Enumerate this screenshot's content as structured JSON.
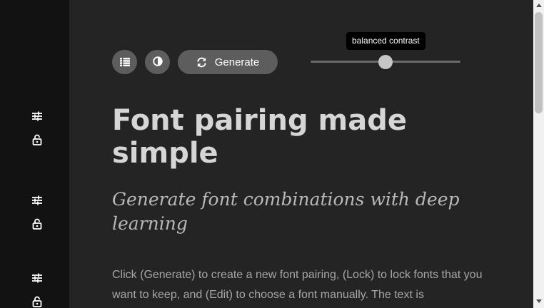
{
  "sidebar": {
    "groups": [
      {
        "settings_icon": "tune-icon",
        "lock_icon": "lock-open-icon"
      },
      {
        "settings_icon": "tune-icon",
        "lock_icon": "lock-open-icon"
      },
      {
        "settings_icon": "tune-icon",
        "lock_icon": "lock-open-icon"
      }
    ]
  },
  "toolbar": {
    "list_icon": "list-icon",
    "contrast_icon": "contrast-icon",
    "generate_label": "Generate",
    "generate_icon": "refresh-icon"
  },
  "contrast_slider": {
    "tooltip": "balanced contrast",
    "value_percent": 50
  },
  "content": {
    "headline": "Font pairing made simple",
    "subheadline": "Generate font combinations with deep learning",
    "body": "Click (Generate) to create a new font pairing, (Lock) to lock fonts that you want to keep, and (Edit) to choose a font manually. The text is"
  },
  "colors": {
    "sidebar_bg": "#121212",
    "main_bg": "#242424",
    "button_bg": "#5d5d5d",
    "heading": "#d6d6d6"
  }
}
